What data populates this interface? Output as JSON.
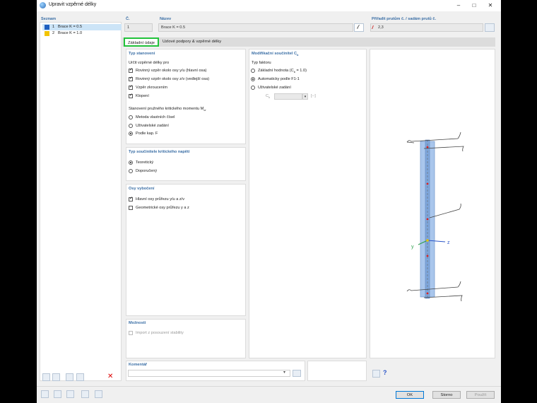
{
  "window": {
    "title": "Upravit vzpěrné délky"
  },
  "list": {
    "header": "Seznam",
    "items": [
      {
        "num": "1",
        "name": "Brace K = 0.5",
        "color": "#1f5fbf"
      },
      {
        "num": "2",
        "name": "Brace K = 1.0",
        "color": "#f2c400"
      }
    ]
  },
  "header": {
    "no_label": "Č.",
    "no_value": "1",
    "name_label": "Název",
    "name_value": "Brace K = 0.5",
    "assigned_label": "Přiřadit prutům č. / sadám prutů č.",
    "assigned_value": "2,3"
  },
  "tabs": [
    "Základní údaje",
    "Uzlové podpory & vzpěrné délky"
  ],
  "typ": {
    "title": "Typ stanovení",
    "subtitle": "Určit vzpěrné délky pro",
    "checks": [
      {
        "label": "Rovinný vzpěr okolo osy y/u (hlavní osa)",
        "on": true
      },
      {
        "label": "Rovinný vzpěr okolo osy z/v (vedlejší osa)",
        "on": true
      },
      {
        "label": "Vzpěr zkroucením",
        "on": true
      },
      {
        "label": "Klopení",
        "on": true
      }
    ],
    "mcr_title": "Stanovení pružného kritického momentu M",
    "mcr_sub": "cr",
    "radios": [
      {
        "label": "Metoda vlastních čísel",
        "on": false
      },
      {
        "label": "Uživatelské zadání",
        "on": false
      },
      {
        "label": "Podle kap. F",
        "on": true
      }
    ]
  },
  "modif": {
    "title": "Modifikační součinitel C",
    "title_sub": "b",
    "subtitle": "Typ faktoru",
    "radios": [
      {
        "label": "Základní hodnota (C",
        "sub": "b",
        "tail": " = 1.0)",
        "on": false
      },
      {
        "label": "Automaticky podle F1-1",
        "sub": "",
        "tail": "",
        "on": true
      },
      {
        "label": "Uživatelské zadání",
        "sub": "",
        "tail": "",
        "on": false
      }
    ],
    "cb_label": "C",
    "cb_sub": "b",
    "cb_unit": "[--]"
  },
  "kritnap": {
    "title": "Typ součinitele kritického napětí",
    "radios": [
      {
        "label": "Teoretický",
        "on": true
      },
      {
        "label": "Doporučený",
        "on": false
      }
    ]
  },
  "osy": {
    "title": "Osy vybočení",
    "checks": [
      {
        "label": "Hlavní osy průřezu y/u a z/v",
        "on": true
      },
      {
        "label": "Geometrické osy průřezu y a z",
        "on": false
      }
    ]
  },
  "moznosti": {
    "title": "Možnosti",
    "check": {
      "label": "Import z posouzení stability",
      "on": false
    }
  },
  "komentar": {
    "title": "Komentář"
  },
  "view3d": {
    "y_label": "y",
    "z_label": "z"
  },
  "buttons": {
    "ok": "OK",
    "cancel": "Storno",
    "apply": "Použít"
  }
}
